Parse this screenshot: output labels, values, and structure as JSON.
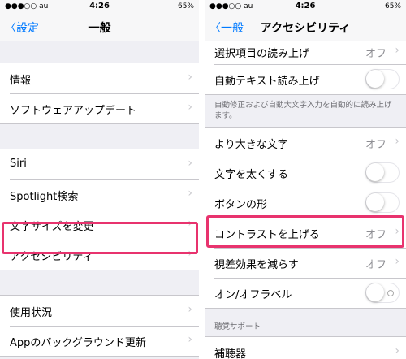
{
  "colors": {
    "accent": "#007aff",
    "highlight": "#e8336e"
  },
  "left": {
    "status": {
      "carrier": "●●●○○ au",
      "time": "4:26",
      "battery": "65%"
    },
    "nav": {
      "back": "設定",
      "title": "一般"
    },
    "group1": [
      "情報",
      "ソフトウェアアップデート"
    ],
    "group2": [
      "Siri",
      "Spotlight検索",
      "文字サイズを変更",
      "アクセシビリティ"
    ],
    "group3": [
      "使用状況",
      "Appのバックグラウンド更新"
    ]
  },
  "right": {
    "status": {
      "carrier": "●●●○○ au",
      "time": "4:26",
      "battery": "65%"
    },
    "nav": {
      "back": "一般",
      "title": "アクセシビリティ"
    },
    "row_top": {
      "label": "選択項目の読み上げ",
      "value": "オフ"
    },
    "row_auto": {
      "label": "自動テキスト読み上げ"
    },
    "footnote": "自動修正および自動大文字入力を自動的に読み上げます。",
    "rows": [
      {
        "label": "より大きな文字",
        "value": "オフ"
      },
      {
        "label": "文字を太くする"
      },
      {
        "label": "ボタンの形"
      },
      {
        "label": "コントラストを上げる",
        "value": "オフ"
      },
      {
        "label": "視差効果を減らす",
        "value": "オフ"
      },
      {
        "label": "オン/オフラベル"
      }
    ],
    "hearing_header": "聴覚サポート",
    "hearing_rows": [
      {
        "label": "補聴器"
      }
    ]
  }
}
